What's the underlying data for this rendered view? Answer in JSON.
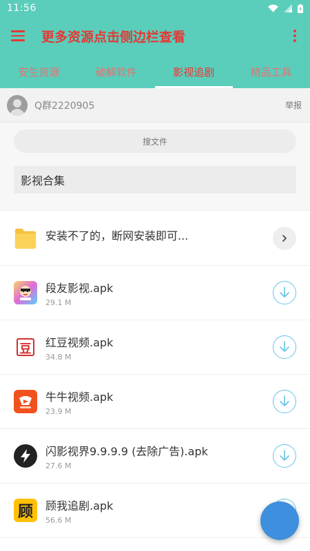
{
  "status_bar": {
    "time": "11:56"
  },
  "app_bar": {
    "title": "更多资源点击侧边栏查看"
  },
  "tabs": [
    {
      "label": "安生资源",
      "active": false
    },
    {
      "label": "破解软件",
      "active": false
    },
    {
      "label": "影视追剧",
      "active": true
    },
    {
      "label": "精品工具",
      "active": false
    }
  ],
  "user": {
    "name": "Q群2220905",
    "report_label": "举报"
  },
  "search": {
    "placeholder": "搜文件"
  },
  "folder": {
    "title": "影视合集"
  },
  "folder_item": {
    "name": "安装不了的，断网安装即可..."
  },
  "files": [
    {
      "name": "段友影视.apk",
      "size": "29.1 M",
      "icon": "duanyou-app-icon"
    },
    {
      "name": "红豆视频.apk",
      "size": "34.8 M",
      "icon": "hongdou-app-icon",
      "icon_text": "豆"
    },
    {
      "name": "牛牛视频.apk",
      "size": "23.9 M",
      "icon": "niuniu-app-icon"
    },
    {
      "name": "闪影视界9.9.9.9 (去除广告).apk",
      "size": "27.6 M",
      "icon": "lightning-app-icon"
    },
    {
      "name": "顾我追剧.apk",
      "size": "56.6 M",
      "icon": "guwo-app-icon",
      "icon_text": "顾"
    }
  ],
  "colors": {
    "primary": "#5bcdbb",
    "title_red": "#e53935",
    "fab_blue": "#3e8fdd",
    "download_blue": "#64c4e8"
  }
}
